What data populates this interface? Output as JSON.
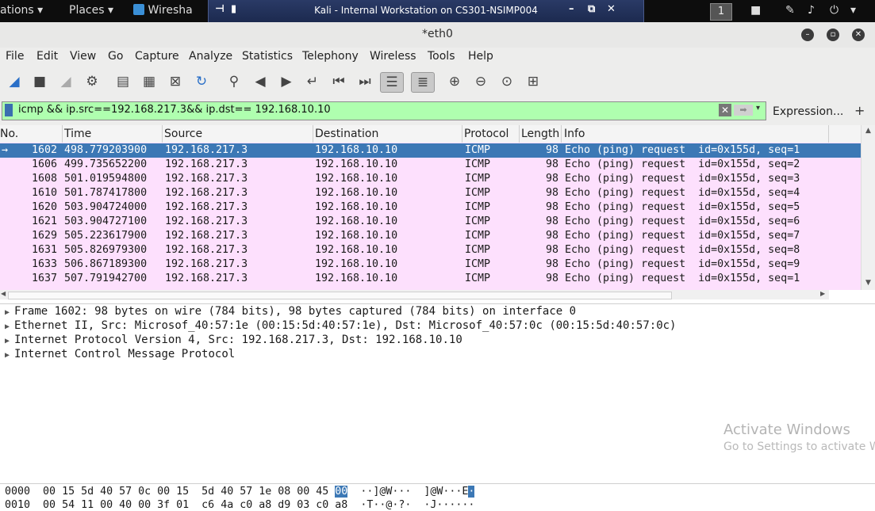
{
  "topbar": {
    "activities_label": "ations",
    "places_label": "Places",
    "app_label": "Wiresha",
    "vm_title": "Kali - Internal Workstation on CS301-NSIMP004",
    "workspace_number": "1"
  },
  "window": {
    "title": "*eth0"
  },
  "menu": [
    "File",
    "Edit",
    "View",
    "Go",
    "Capture",
    "Analyze",
    "Statistics",
    "Telephony",
    "Wireless",
    "Tools",
    "Help"
  ],
  "filter": {
    "text": "icmp && ip.src==192.168.217.3&& ip.dst== 192.168.10.10",
    "expression_label": "Expression...",
    "plus_label": "+"
  },
  "columns": [
    "No.",
    "Time",
    "Source",
    "Destination",
    "Protocol",
    "Length",
    "Info"
  ],
  "packets": [
    {
      "no": "1602",
      "time": "498.779203900",
      "src": "192.168.217.3",
      "dst": "192.168.10.10",
      "proto": "ICMP",
      "len": "98",
      "info": "Echo (ping) request  id=0x155d, seq=1"
    },
    {
      "no": "1606",
      "time": "499.735652200",
      "src": "192.168.217.3",
      "dst": "192.168.10.10",
      "proto": "ICMP",
      "len": "98",
      "info": "Echo (ping) request  id=0x155d, seq=2"
    },
    {
      "no": "1608",
      "time": "501.019594800",
      "src": "192.168.217.3",
      "dst": "192.168.10.10",
      "proto": "ICMP",
      "len": "98",
      "info": "Echo (ping) request  id=0x155d, seq=3"
    },
    {
      "no": "1610",
      "time": "501.787417800",
      "src": "192.168.217.3",
      "dst": "192.168.10.10",
      "proto": "ICMP",
      "len": "98",
      "info": "Echo (ping) request  id=0x155d, seq=4"
    },
    {
      "no": "1620",
      "time": "503.904724000",
      "src": "192.168.217.3",
      "dst": "192.168.10.10",
      "proto": "ICMP",
      "len": "98",
      "info": "Echo (ping) request  id=0x155d, seq=5"
    },
    {
      "no": "1621",
      "time": "503.904727100",
      "src": "192.168.217.3",
      "dst": "192.168.10.10",
      "proto": "ICMP",
      "len": "98",
      "info": "Echo (ping) request  id=0x155d, seq=6"
    },
    {
      "no": "1629",
      "time": "505.223617900",
      "src": "192.168.217.3",
      "dst": "192.168.10.10",
      "proto": "ICMP",
      "len": "98",
      "info": "Echo (ping) request  id=0x155d, seq=7"
    },
    {
      "no": "1631",
      "time": "505.826979300",
      "src": "192.168.217.3",
      "dst": "192.168.10.10",
      "proto": "ICMP",
      "len": "98",
      "info": "Echo (ping) request  id=0x155d, seq=8"
    },
    {
      "no": "1633",
      "time": "506.867189300",
      "src": "192.168.217.3",
      "dst": "192.168.10.10",
      "proto": "ICMP",
      "len": "98",
      "info": "Echo (ping) request  id=0x155d, seq=9"
    },
    {
      "no": "1637",
      "time": "507.791942700",
      "src": "192.168.217.3",
      "dst": "192.168.10.10",
      "proto": "ICMP",
      "len": "98",
      "info": "Echo (ping) request  id=0x155d, seq=1"
    }
  ],
  "details": [
    "Frame 1602: 98 bytes on wire (784 bits), 98 bytes captured (784 bits) on interface 0",
    "Ethernet II, Src: Microsof_40:57:1e (00:15:5d:40:57:1e), Dst: Microsof_40:57:0c (00:15:5d:40:57:0c)",
    "Internet Protocol Version 4, Src: 192.168.217.3, Dst: 192.168.10.10",
    "Internet Control Message Protocol"
  ],
  "watermark": {
    "line1": "Activate Windows",
    "line2": "Go to Settings to activate Wi"
  },
  "bytes": [
    {
      "offset": "0000",
      "hex": "00 15 5d 40 57 0c 00 15  5d 40 57 1e 08 00 45 ",
      "hex_hl": "00",
      "ascii": "  ··]@W···  ]@W···E",
      "ascii_hl": "·"
    },
    {
      "offset": "0010",
      "hex": "00 54 11 00 40 00 3f 01  c6 4a c0 a8 d9 03 c0 a8",
      "hex_hl": "",
      "ascii": "  ·T··@·?·  ·J······",
      "ascii_hl": ""
    }
  ],
  "colors": {
    "selected_row": "#3c78b5",
    "icmp_row": "#fde0fd",
    "filter_valid": "#afffaf"
  }
}
